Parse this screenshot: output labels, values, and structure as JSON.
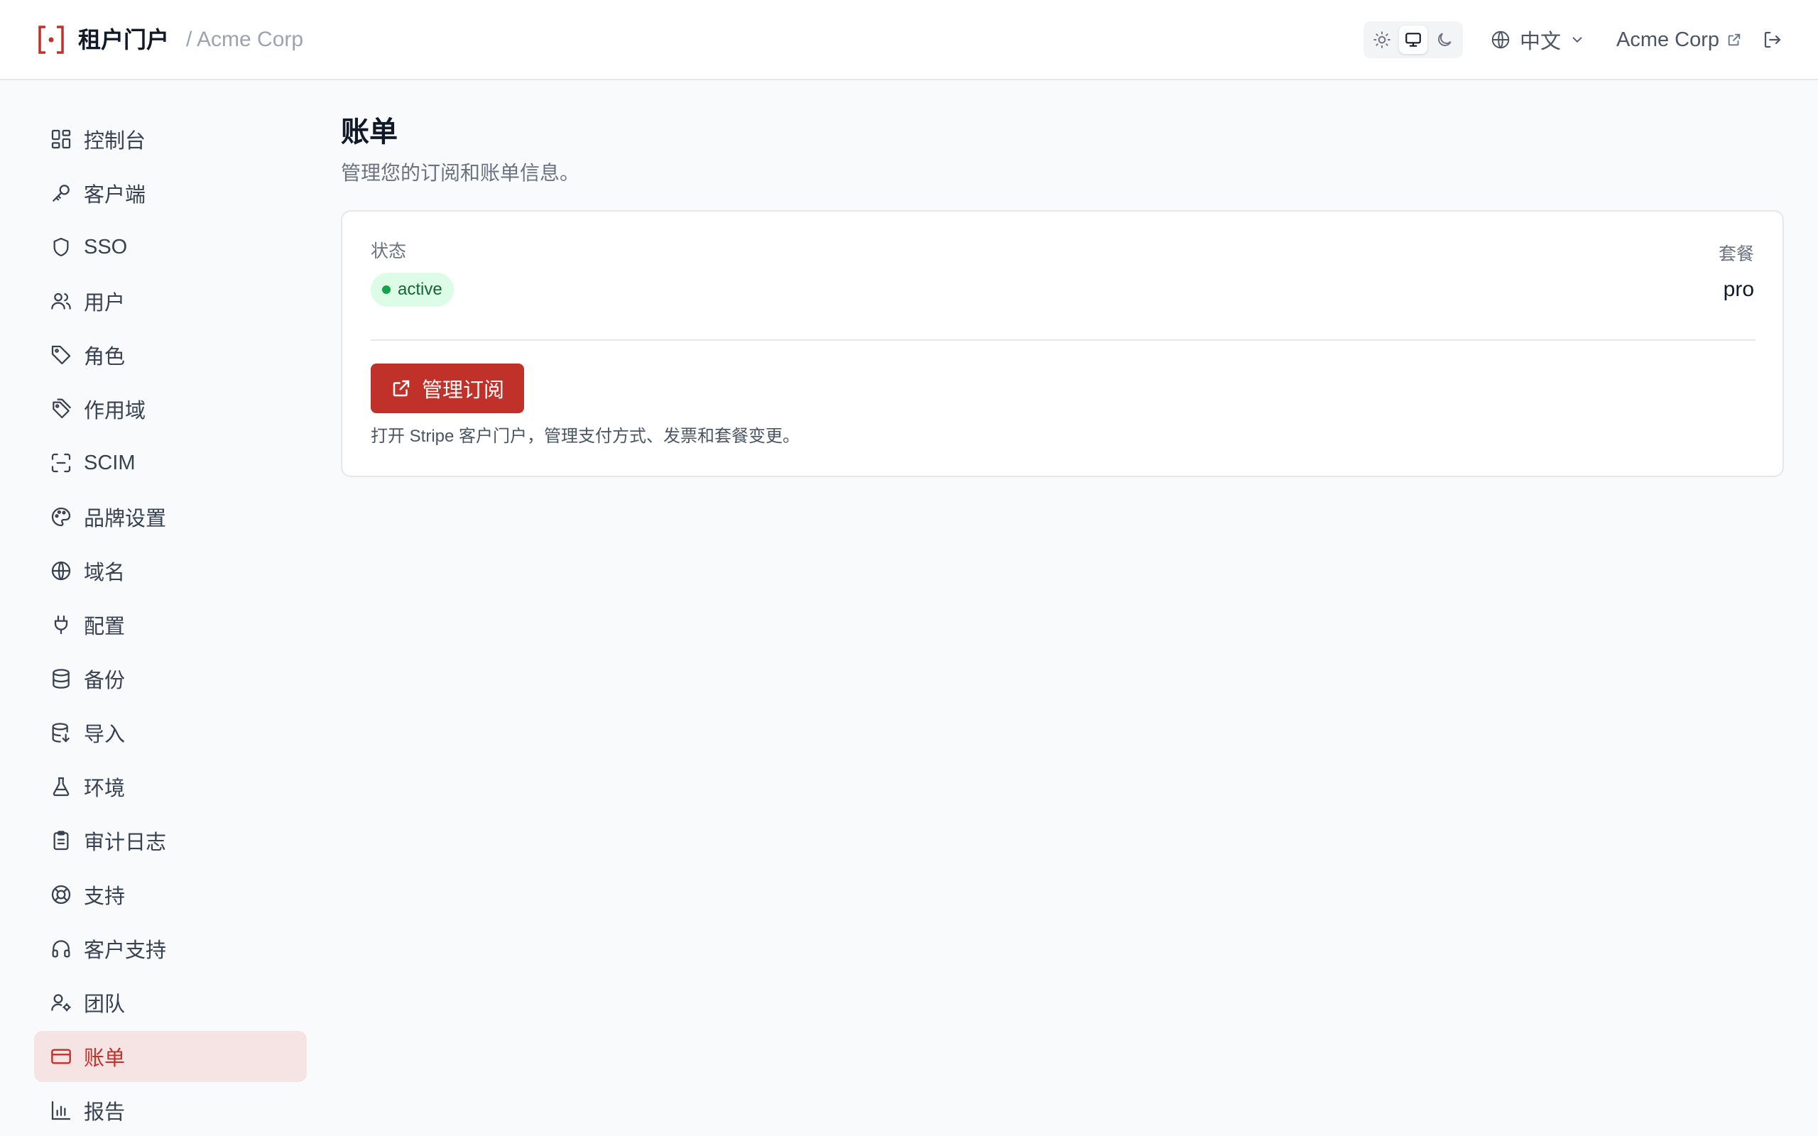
{
  "header": {
    "brand_title": "租户门户",
    "breadcrumb": "/ Acme Corp",
    "theme_modes": [
      "sun-icon",
      "monitor-icon",
      "moon-icon"
    ],
    "active_theme": "monitor-icon",
    "language": "中文",
    "tenant_name": "Acme Corp",
    "accent_color": "#c0312a"
  },
  "sidebar": {
    "items": [
      {
        "label": "控制台",
        "icon": "dashboard-icon"
      },
      {
        "label": "客户端",
        "icon": "key-icon"
      },
      {
        "label": "SSO",
        "icon": "shield-icon"
      },
      {
        "label": "用户",
        "icon": "users-icon"
      },
      {
        "label": "角色",
        "icon": "tag-icon"
      },
      {
        "label": "作用域",
        "icon": "tags-icon"
      },
      {
        "label": "SCIM",
        "icon": "scan-icon"
      },
      {
        "label": "品牌设置",
        "icon": "palette-icon"
      },
      {
        "label": "域名",
        "icon": "globe-icon"
      },
      {
        "label": "配置",
        "icon": "plug-icon"
      },
      {
        "label": "备份",
        "icon": "database-icon"
      },
      {
        "label": "导入",
        "icon": "database-import-icon"
      },
      {
        "label": "环境",
        "icon": "flask-icon"
      },
      {
        "label": "审计日志",
        "icon": "clipboard-icon"
      },
      {
        "label": "支持",
        "icon": "lifebuoy-icon"
      },
      {
        "label": "客户支持",
        "icon": "headphones-icon"
      },
      {
        "label": "团队",
        "icon": "user-cog-icon"
      },
      {
        "label": "账单",
        "icon": "credit-card-icon",
        "active": true
      },
      {
        "label": "报告",
        "icon": "bar-chart-icon"
      }
    ]
  },
  "main": {
    "title": "账单",
    "subtitle": "管理您的订阅和账单信息。",
    "status_label": "状态",
    "status_value": "active",
    "plan_label": "套餐",
    "plan_value": "pro",
    "manage_button": "管理订阅",
    "manage_hint": "打开 Stripe 客户门户，管理支付方式、发票和套餐变更。"
  }
}
